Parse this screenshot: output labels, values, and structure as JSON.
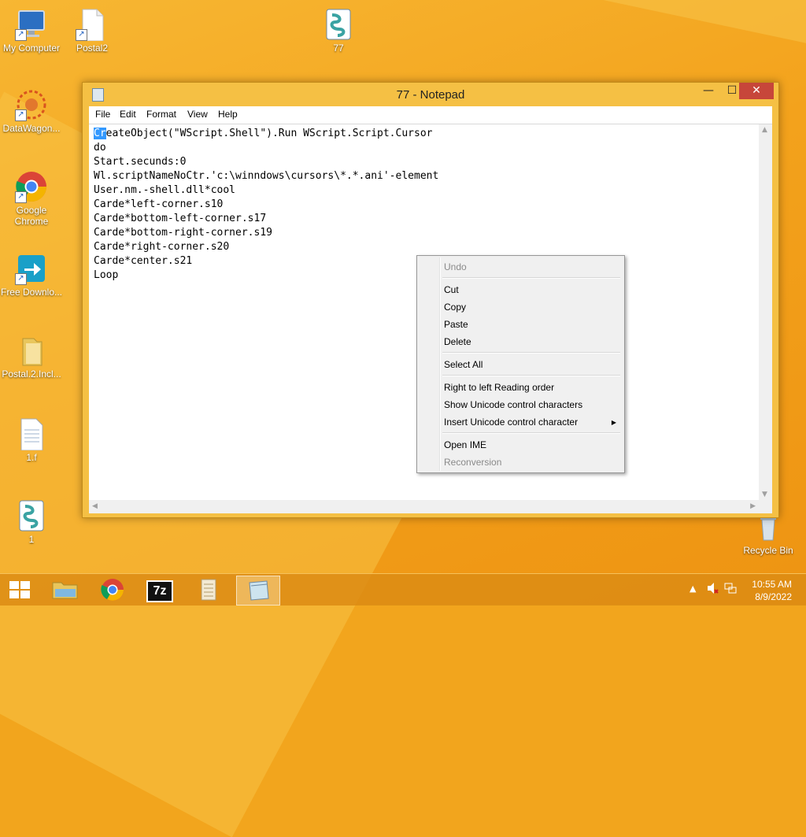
{
  "desktop": {
    "icons": [
      {
        "label": "My Computer"
      },
      {
        "label": "Postal2"
      },
      {
        "label": "77"
      },
      {
        "label": "DataWagon..."
      },
      {
        "label": "Google Chrome"
      },
      {
        "label": "Free Downlo..."
      },
      {
        "label": "Postal.2.Incl..."
      },
      {
        "label": "1.f"
      },
      {
        "label": "1"
      },
      {
        "label": "Recycle Bin"
      }
    ]
  },
  "notepad": {
    "title": "77 - Notepad",
    "buttons": {
      "minimize": "—",
      "maximize": "☐",
      "close": "✕"
    },
    "menu": [
      "File",
      "Edit",
      "Format",
      "View",
      "Help"
    ],
    "selected_text": "Cr",
    "lines": [
      "eateObject(\"WScript.Shell\").Run WScript.Script.Cursor",
      "do",
      "Start.secunds:0",
      "Wl.scriptNameNoCtr.'c:\\winndows\\cursors\\*.*.ani'-element",
      "User.nm.-shell.dll*cool",
      "Carde*left-corner.s10",
      "Carde*bottom-left-corner.s17",
      "Carde*bottom-right-corner.s19",
      "Carde*right-corner.s20",
      "Carde*center.s21",
      "Loop"
    ]
  },
  "context_menu": {
    "items": [
      {
        "label": "Undo",
        "enabled": false
      },
      {
        "label": "Cut",
        "enabled": true
      },
      {
        "label": "Copy",
        "enabled": true
      },
      {
        "label": "Paste",
        "enabled": true
      },
      {
        "label": "Delete",
        "enabled": true
      },
      {
        "label": "Select All",
        "enabled": true
      },
      {
        "label": "Right to left Reading order",
        "enabled": true
      },
      {
        "label": "Show Unicode control characters",
        "enabled": true
      },
      {
        "label": "Insert Unicode control character",
        "enabled": true,
        "submenu": true
      },
      {
        "label": "Open IME",
        "enabled": true
      },
      {
        "label": "Reconversion",
        "enabled": false
      }
    ],
    "submenu_arrow": "▶"
  },
  "taskbar": {
    "apps": [
      "File Explorer",
      "Google Chrome",
      "7-Zip",
      "Script",
      "Notepad"
    ],
    "seven_zip_label": "7z",
    "tray_up_arrow": "▲",
    "time": "10:55 AM",
    "date": "8/9/2022"
  },
  "colors": {
    "accent": "#f5c044",
    "close": "#c7463a",
    "selection": "#3399ff"
  }
}
